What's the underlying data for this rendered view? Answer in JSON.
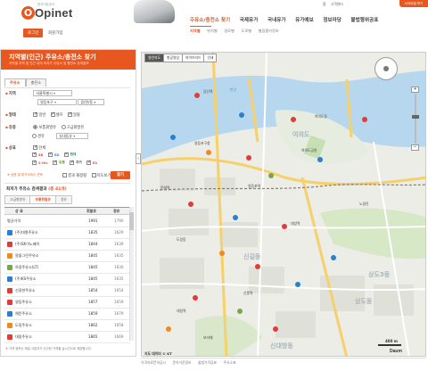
{
  "header": {
    "logo_text": "Opinet",
    "logo_letter": "O",
    "logo_sub": "한국석유공사",
    "login_label": "로그인",
    "join_label": "회원가입",
    "util_links": [
      "홈",
      "고객센터"
    ],
    "util_orange": "사이트맵 보기",
    "gnb": [
      "주유소/충전소 찾기",
      "국제유가",
      "국내유가",
      "유가예보",
      "정보마당",
      "불법행위공표"
    ],
    "lnb": [
      "지역별",
      "위치별",
      "경로별",
      "도로별",
      "별점평가정보"
    ]
  },
  "panel": {
    "title": "지역별(인근) 주유소/충전소 찾기",
    "desc": "지역별 지역 및 인근 내의 최저가 주유소 및 충전소 상세정보",
    "tabs": [
      "주유소",
      "충전소"
    ],
    "region_label": "지역",
    "region_city": "서울특별시",
    "region_district": "영등포구",
    "region_dong": "읍/면/동",
    "fuel_label": "형태",
    "fuel_opts": [
      "일반",
      "셀프",
      "알뜰"
    ],
    "fuel_type_label": "유종",
    "fuel_type_opts": [
      "보통휘발유",
      "고급휘발유"
    ],
    "fuel_type_opts2": [
      "경유",
      "실내등유"
    ],
    "service_label": "상표",
    "service_all": "전체",
    "brands": [
      "SK",
      "GS",
      "현대",
      "S-OIL",
      "알뜰",
      "자가",
      "E1"
    ],
    "checkbox_extra": [
      "결과 재정렬",
      "지도보기"
    ],
    "note": "※ 상표 및 부가서비스 선택",
    "search_label": "찾기",
    "result_title": "최저가 주유소 검색결과",
    "result_count": "(총 41개)",
    "result_tabs": [
      "고급휘발유",
      "보통휘발유",
      "경유"
    ],
    "col_name": "상 호",
    "col_price": "휘발유",
    "col_dist": "경유",
    "footnote": "※ 가격 정보는 매일 사업자가 신고한 가격을 실시간으로 제공합니다."
  },
  "stations": [
    {
      "name": "평균가격",
      "price": "1991",
      "dist": "1790",
      "color": "#ffffff"
    },
    {
      "name": "(주)대명주유소",
      "price": "1835",
      "dist": "1629",
      "color": "#2a7fd0"
    },
    {
      "name": "(주)SK이노베이",
      "price": "1844",
      "dist": "1639",
      "color": "#e03c3c"
    },
    {
      "name": "알뜰그린주유소",
      "price": "1845",
      "dist": "1635",
      "color": "#f08a1c"
    },
    {
      "name": "하광주유소(LT)",
      "price": "1845",
      "dist": "1630",
      "color": "#7aa54a"
    },
    {
      "name": "(주)KS주유소",
      "price": "1845",
      "dist": "1635",
      "color": "#2a7fd0"
    },
    {
      "name": "신광한주유소",
      "price": "1854",
      "dist": "1654",
      "color": "#e03c3c"
    },
    {
      "name": "영등주유소",
      "price": "1857",
      "dist": "1659",
      "color": "#e03c3c"
    },
    {
      "name": "해운주유소",
      "price": "1859",
      "dist": "1679",
      "color": "#2a7fd0"
    },
    {
      "name": "도림주유소",
      "price": "1862",
      "dist": "1658",
      "color": "#f08a1c"
    },
    {
      "name": "대림주유소",
      "price": "1865",
      "dist": "1669",
      "color": "#e03c3c"
    }
  ],
  "map": {
    "tabs": [
      "일반지도",
      "항공영상",
      "하이브리드",
      "인쇄"
    ],
    "zoom_in": "+",
    "zoom_out": "−",
    "scale": "400 m",
    "copyright": "지도 데이터 © KT",
    "brand": "Daum",
    "labels": [
      "당산역",
      "영등포구청",
      "여의도",
      "여의도동",
      "영등포역",
      "대방역",
      "신길동",
      "대림역",
      "신풍역",
      "신대방동",
      "노량진",
      "한강",
      "상도3동",
      "상도동",
      "여의도공원",
      "문래역",
      "도림동",
      "보라매"
    ]
  },
  "footer": [
    "가격자료문의공시",
    "문의기준정보",
    "불법가격공표",
    "주유소표"
  ]
}
